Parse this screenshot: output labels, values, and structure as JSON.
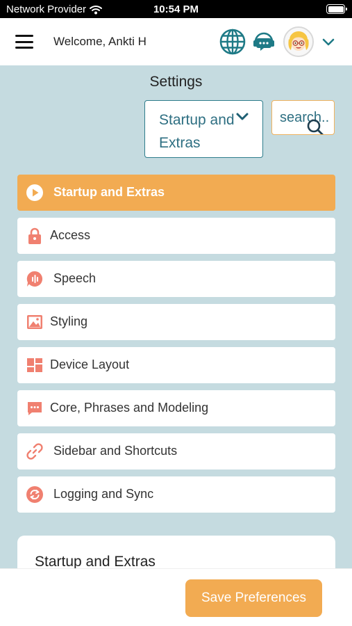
{
  "status_bar": {
    "carrier": "Network Provider",
    "time": "10:54 PM",
    "battery_level": 1.0
  },
  "header": {
    "welcome_text": "Welcome, Ankti H",
    "icons": [
      "menu-icon",
      "globe-icon",
      "support-chat-icon",
      "user-avatar",
      "chevron-down-icon"
    ]
  },
  "settings": {
    "title": "Settings",
    "category_select": {
      "value": "Startup and Extras"
    },
    "search": {
      "placeholder": "search.."
    }
  },
  "menu": {
    "items": [
      {
        "label": "Startup and Extras",
        "icon": "play-circle-icon",
        "active": true
      },
      {
        "label": "Access",
        "icon": "lock-icon",
        "active": false
      },
      {
        "label": "Speech",
        "icon": "speech-icon",
        "active": false
      },
      {
        "label": "Styling",
        "icon": "image-icon",
        "active": false
      },
      {
        "label": "Device Layout",
        "icon": "layout-icon",
        "active": false
      },
      {
        "label": "Core, Phrases and Modeling",
        "icon": "message-icon",
        "active": false
      },
      {
        "label": "Sidebar and Shortcuts",
        "icon": "link-icon",
        "active": false
      },
      {
        "label": "Logging and Sync",
        "icon": "sync-icon",
        "active": false
      }
    ]
  },
  "section": {
    "title": "Startup and Extras"
  },
  "footer": {
    "save_label": "Save Preferences"
  },
  "colors": {
    "accent_orange": "#f2ab52",
    "icon_coral": "#f08070",
    "teal": "#1e7a86",
    "background": "#c5dbe0"
  }
}
